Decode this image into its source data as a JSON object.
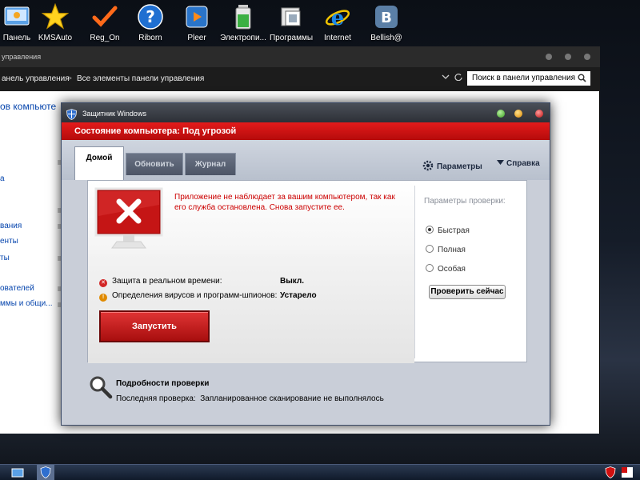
{
  "desktop": {
    "icons": [
      {
        "label": "Панель",
        "icon": "control-panel-icon"
      },
      {
        "label": "KMSAuto",
        "icon": "star-icon"
      },
      {
        "label": "Reg_On",
        "icon": "checkmark-icon"
      },
      {
        "label": "Riborn",
        "icon": "help-icon"
      },
      {
        "label": "Pleer",
        "icon": "media-player-icon"
      },
      {
        "label": "Электропи...",
        "icon": "battery-icon"
      },
      {
        "label": "Программы",
        "icon": "programs-icon"
      },
      {
        "label": "Internet",
        "icon": "internet-explorer-icon"
      },
      {
        "label": "Bellish@",
        "icon": "vk-icon"
      }
    ]
  },
  "control_panel": {
    "title": "управления",
    "breadcrumb_root": "анель управления",
    "breadcrumb_sep": ">",
    "breadcrumb_current": "Все элементы панели управления",
    "search_placeholder": "Поиск в панели управления",
    "heading_fragment": "ов компьюте",
    "side_links": [
      "а",
      "вания",
      "енты",
      "ты",
      "ователей",
      "ммы и общи..."
    ]
  },
  "defender": {
    "title": "Защитник Windows",
    "status_bar": "Состояние компьютера: Под угрозой",
    "tabs": [
      {
        "label": "Домой",
        "active": true
      },
      {
        "label": "Обновить",
        "active": false
      },
      {
        "label": "Журнал",
        "active": false
      }
    ],
    "settings_label": "Параметры",
    "help_label": "Справка",
    "alert_message": "Приложение не наблюдает за вашим компьютером, так как его служба остановлена. Снова запустите ее.",
    "status_items": [
      {
        "label": "Защита в реальном времени:",
        "value": "Выкл.",
        "icon": "error-icon",
        "color": "#d22626"
      },
      {
        "label": "Определения вирусов и программ-шпионов:",
        "value": "Устарело",
        "icon": "warning-icon",
        "color": "#e08a00"
      }
    ],
    "start_button": "Запустить",
    "scan_options_title": "Параметры проверки:",
    "scan_options": [
      {
        "label": "Быстрая",
        "selected": true
      },
      {
        "label": "Полная",
        "selected": false
      },
      {
        "label": "Особая",
        "selected": false
      }
    ],
    "scan_now_button": "Проверить сейчас",
    "details_title": "Подробности проверки",
    "last_scan_label": "Последняя проверка:",
    "last_scan_value": "Запланированное сканирование не выполнялось"
  },
  "colors": {
    "danger_red": "#d01010",
    "alert_text": "#cc0000",
    "titlebar_dark": "#2b2b2b"
  }
}
